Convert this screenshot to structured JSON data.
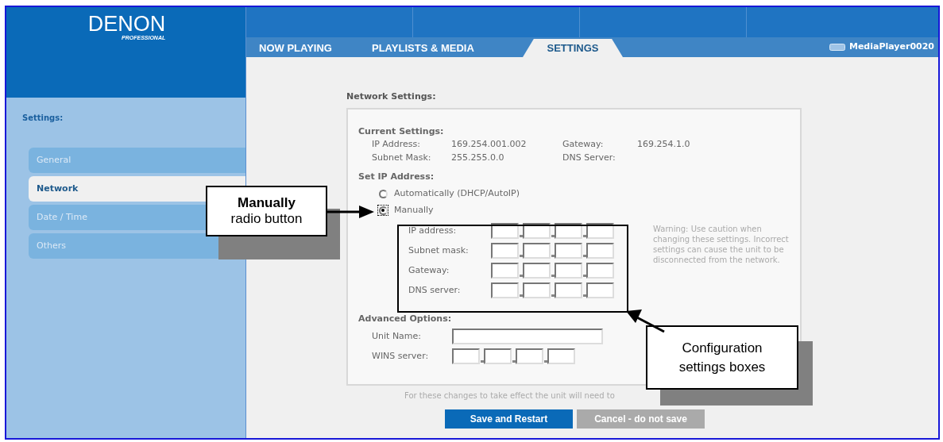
{
  "logo": {
    "brand": "DENON",
    "sub": "PROFESSIONAL"
  },
  "tabs": [
    {
      "label": "NOW PLAYING",
      "selected": false
    },
    {
      "label": "PLAYLISTS & MEDIA",
      "selected": false
    },
    {
      "label": "SETTINGS",
      "selected": true
    }
  ],
  "device_name": "MediaPlayer0020",
  "sidebar": {
    "title": "Settings:",
    "items": [
      {
        "label": "General",
        "selected": false
      },
      {
        "label": "Network",
        "selected": true
      },
      {
        "label": "Date / Time",
        "selected": false
      },
      {
        "label": "Others",
        "selected": false
      }
    ]
  },
  "page_title": "Network Settings:",
  "current_settings": {
    "heading": "Current Settings:",
    "rows": [
      [
        {
          "label": "IP Address:",
          "value": "169.254.001.002"
        },
        {
          "label": "Gateway:",
          "value": "169.254.1.0"
        }
      ],
      [
        {
          "label": "Subnet Mask:",
          "value": "255.255.0.0"
        },
        {
          "label": "DNS Server:"
        }
      ]
    ]
  },
  "set_ip": {
    "heading": "Set IP Address:",
    "options": [
      {
        "label": "Automatically (DHCP/AutoIP)",
        "selected": false
      },
      {
        "label": "Manually",
        "selected": true
      }
    ],
    "fields": [
      {
        "label": "IP address:"
      },
      {
        "label": "Subnet mask:"
      },
      {
        "label": "Gateway:"
      },
      {
        "label": "DNS server:"
      }
    ],
    "warning": "Warning: Use caution when changing these settings. Incorrect settings can cause the unit to be disconnected from the network."
  },
  "advanced": {
    "heading": "Advanced Options:",
    "fields": [
      {
        "label": "Unit Name:",
        "kind": "text"
      },
      {
        "label": "WINS server:",
        "kind": "ip"
      }
    ]
  },
  "footer_note": "For these changes to take effect the unit will need to",
  "buttons": [
    {
      "label": "Save and Restart",
      "kind": "primary"
    },
    {
      "label": "Cancel - do not save",
      "kind": "secondary"
    }
  ],
  "callouts": [
    {
      "text": "**Manually** radio button"
    },
    {
      "text": "Configuration settings boxes"
    }
  ]
}
